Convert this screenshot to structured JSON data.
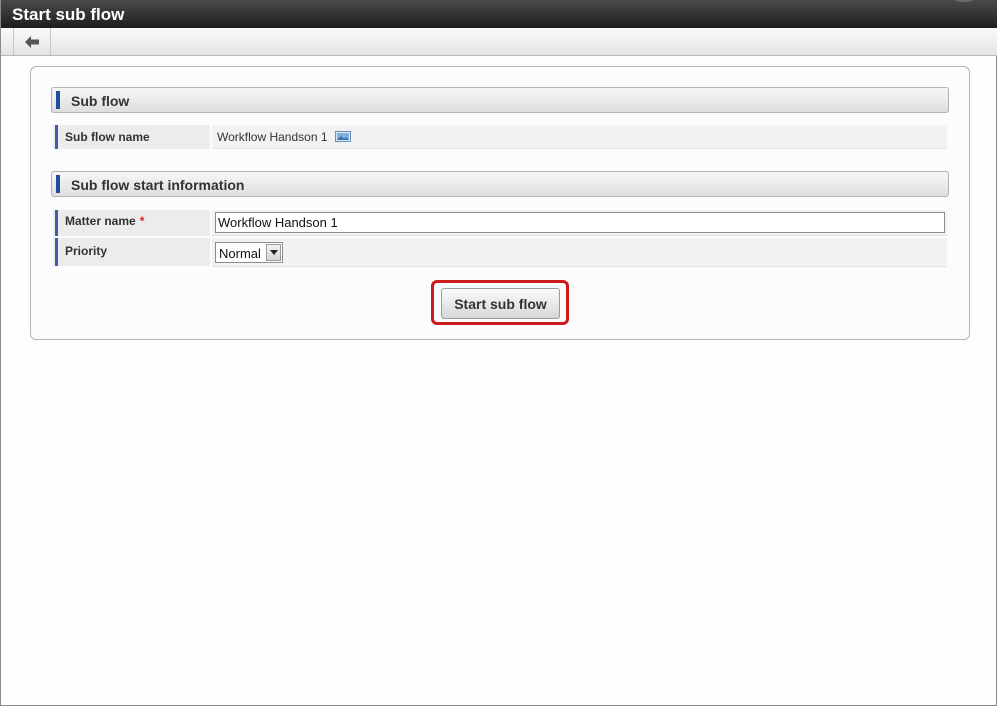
{
  "window": {
    "title": "Start sub flow"
  },
  "toolbar": {
    "back_icon": "arrow-left-icon"
  },
  "section_subflow": {
    "header": "Sub flow",
    "subflow_name_label": "Sub flow name",
    "subflow_name_value": "Workflow Handson 1",
    "subflow_name_icon": "image-icon"
  },
  "section_start_info": {
    "header": "Sub flow start information",
    "matter_name_label": "Matter name",
    "matter_name_required": "*",
    "matter_name_value": "Workflow Handson 1",
    "priority_label": "Priority",
    "priority_value": "Normal"
  },
  "actions": {
    "start_button": "Start sub flow"
  },
  "colors": {
    "highlight": "#cc1b1b",
    "accent": "#1f4e9d",
    "titlebar": "#2a2a2a"
  }
}
